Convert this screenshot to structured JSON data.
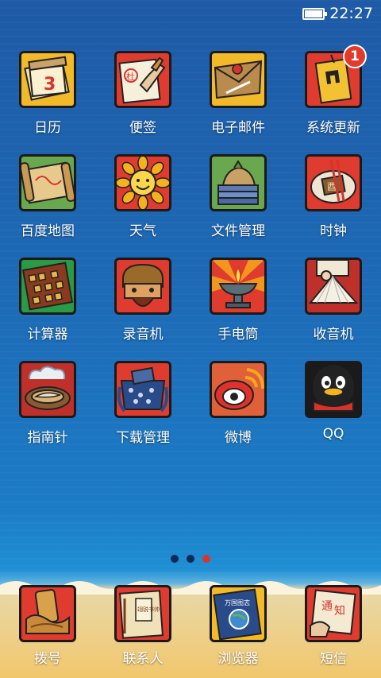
{
  "status_bar": {
    "time": "22:27",
    "battery_level": 1.0
  },
  "apps": [
    {
      "label": "日历",
      "icon": "calendar-icon",
      "tile_color": "#f2b928"
    },
    {
      "label": "便签",
      "icon": "notes-icon",
      "tile_color": "#e03b2f"
    },
    {
      "label": "电子邮件",
      "icon": "email-icon",
      "tile_color": "#f2b928"
    },
    {
      "label": "系统更新",
      "icon": "system-update-icon",
      "tile_color": "#e03b2f",
      "badge": "1"
    },
    {
      "label": "百度地图",
      "icon": "map-icon",
      "tile_color": "#6aa84f"
    },
    {
      "label": "天气",
      "icon": "weather-sun-icon",
      "tile_color": "#e03b2f"
    },
    {
      "label": "文件管理",
      "icon": "file-manager-icon",
      "tile_color": "#6aa84f"
    },
    {
      "label": "时钟",
      "icon": "clock-icon",
      "tile_color": "#e03b2f"
    },
    {
      "label": "计算器",
      "icon": "calculator-abacus-icon",
      "tile_color": "#2b9a47"
    },
    {
      "label": "录音机",
      "icon": "recorder-mask-icon",
      "tile_color": "#e03b2f"
    },
    {
      "label": "手电筒",
      "icon": "flashlight-lamp-icon",
      "tile_color": "#e03b2f"
    },
    {
      "label": "收音机",
      "icon": "radio-fan-icon",
      "tile_color": "#c0302b"
    },
    {
      "label": "指南针",
      "icon": "compass-icon",
      "tile_color": "#c0302b"
    },
    {
      "label": "下载管理",
      "icon": "download-bag-icon",
      "tile_color": "#e03b2f"
    },
    {
      "label": "微博",
      "icon": "weibo-icon",
      "tile_color": "#e0603a"
    },
    {
      "label": "QQ",
      "icon": "qq-penguin-icon",
      "tile_color": "#1a1a1a"
    }
  ],
  "pager": {
    "pages": 3,
    "active": 3
  },
  "dock": [
    {
      "label": "拨号",
      "icon": "phone-scroll-icon",
      "tile_color": "#e03b2f"
    },
    {
      "label": "联系人",
      "icon": "contacts-book-icon",
      "tile_color": "#e03b2f"
    },
    {
      "label": "浏览器",
      "icon": "browser-book-icon",
      "tile_color": "#f2b928"
    },
    {
      "label": "短信",
      "icon": "message-letter-icon",
      "tile_color": "#e03b2f"
    }
  ],
  "icon_text": {
    "calendar_number": "3",
    "notes_char": "杜",
    "clock_char": "酉",
    "dock_messages_chars": [
      "通",
      "知"
    ],
    "browser_title": "万国图志",
    "contacts_title": "翊锐书帅"
  }
}
